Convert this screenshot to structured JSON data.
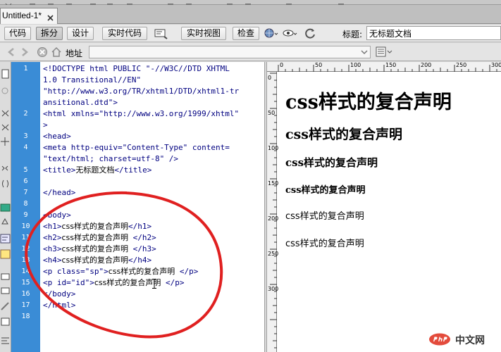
{
  "app": {
    "document_tab": "Untitled-1*"
  },
  "toolbar": {
    "code_label": "代码",
    "split_label": "拆分",
    "design_label": "设计",
    "live_code_label": "实时代码",
    "live_view_label": "实时视图",
    "inspect_label": "检查",
    "title_label": "标题:",
    "title_value": "无标题文档"
  },
  "address": {
    "label": "地址",
    "value": ""
  },
  "line_numbers": [
    "1",
    "2",
    "3",
    "4",
    "5",
    "6",
    "7",
    "8",
    "9",
    "10",
    "11",
    "12",
    "13",
    "14",
    "15",
    "16",
    "17",
    "18"
  ],
  "code": {
    "l1a": "<!DOCTYPE html PUBLIC \"-//W3C//DTD XHTML",
    "l1b": "1.0 Transitional//EN\"",
    "l1c": "\"http://www.w3.org/TR/xhtml1/DTD/xhtml1-tr",
    "l1d": "ansitional.dtd\">",
    "l2a": "<html xmlns=\"http://www.w3.org/1999/xhtml\"",
    "l2b": ">",
    "l3": "<head>",
    "l4a": "<meta http-equiv=\"Content-Type\" content=",
    "l4b": "\"text/html; charset=utf-8\" />",
    "l5_open": "<title>",
    "l5_text": "无标题文档",
    "l5_close": "</title>",
    "l7": "</head>",
    "l9": "<body>",
    "l10_open": "<h1>",
    "l10_text": "css样式的复合声明",
    "l10_close": "</h1>",
    "l11_open": "<h2>",
    "l11_text": "css样式的复合声明",
    "l11_close": " </h2>",
    "l12_open": "<h3>",
    "l12_text": "css样式的复合声明",
    "l12_close": " </h3>",
    "l13_open": "<h4>",
    "l13_text": "css样式的复合声明",
    "l13_close": "</h4>",
    "l14_open": "<p class=\"sp\">",
    "l14_text": "css样式的复合声明",
    "l14_close": " </p>",
    "l15_open": "<p id=\"id\">",
    "l15_text": "css样式的复合声明",
    "l15_close": " </p>",
    "l16": "</body>",
    "l17": "</html>"
  },
  "ruler": {
    "marks": [
      "0",
      "50",
      "100",
      "150",
      "200",
      "250",
      "300"
    ],
    "left_marks": [
      "0",
      "50",
      "100",
      "150",
      "200",
      "250",
      "300"
    ]
  },
  "preview": {
    "h1": "css样式的复合声明",
    "h2": "css样式的复合声明",
    "h3": "css样式的复合声明",
    "h4": "css样式的复合声明",
    "p1": "css样式的复合声明",
    "p2": "css样式的复合声明"
  },
  "watermark": {
    "logo_text": "php",
    "text": "中文网"
  },
  "colors": {
    "gutter": "#3a8cd6",
    "tag": "#000080",
    "annotation": "#e02020"
  }
}
